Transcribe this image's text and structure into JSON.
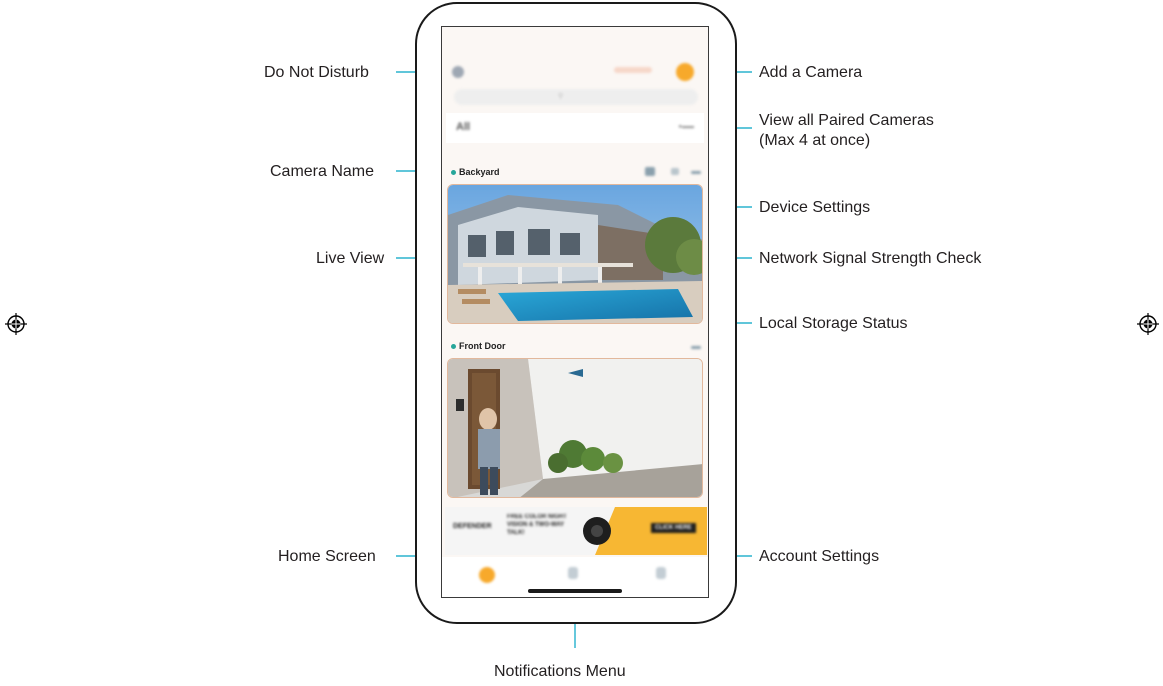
{
  "callouts": {
    "do_not_disturb": "Do Not Disturb",
    "camera_name": "Camera Name",
    "live_view": "Live View",
    "home_screen": "Home Screen",
    "add_camera": "Add a Camera",
    "view_all_line1": "View all Paired Cameras",
    "view_all_line2": "(Max 4 at once)",
    "device_settings": "Device Settings",
    "network_signal": "Network Signal Strength Check",
    "local_storage": "Local Storage Status",
    "account_settings": "Account Settings",
    "notifications_menu": "Notifications Menu"
  },
  "app": {
    "filter_label": "All",
    "cameras": [
      {
        "name": "Backyard",
        "status_color": "#26a69a"
      },
      {
        "name": "Front Door",
        "status_color": "#26a69a"
      }
    ],
    "banner": {
      "left_text": "DEFENDER",
      "mid_text": "FREE COLOR NIGHT VISION & TWO-WAY TALK!",
      "cta": "CLICK HERE"
    }
  },
  "colors": {
    "accent": "#f7a92b",
    "callout_line": "#00a3c4",
    "status": "#26a69a"
  },
  "icons": [
    "do-not-disturb-icon",
    "add-camera-icon",
    "grid-view-icon",
    "local-storage-icon",
    "signal-icon",
    "more-icon",
    "home-icon",
    "notifications-icon",
    "account-icon",
    "registration-mark-icon"
  ]
}
